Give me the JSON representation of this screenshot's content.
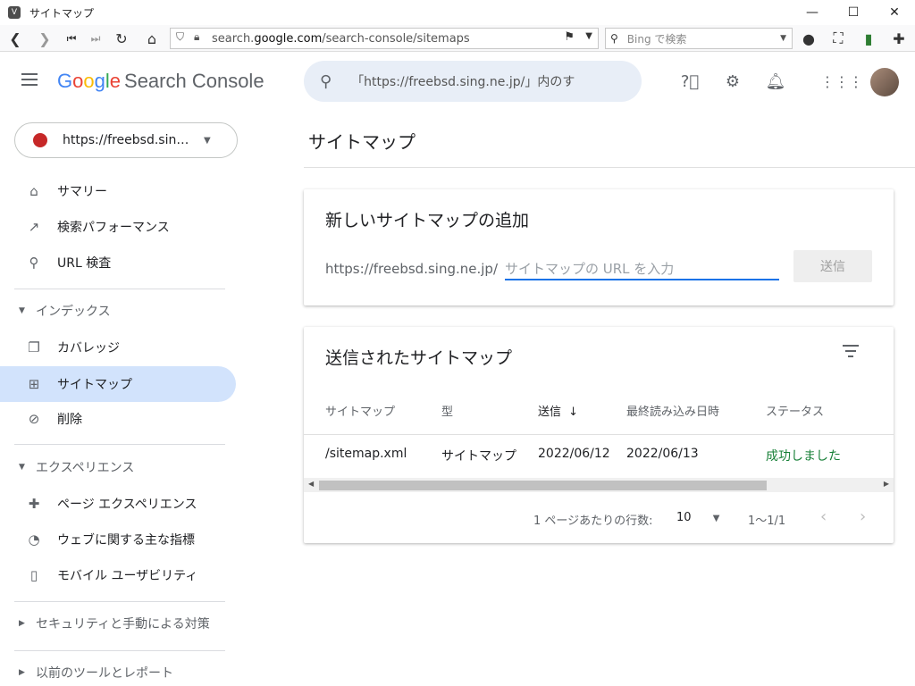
{
  "window": {
    "title": "サイトマップ",
    "minimize": "—",
    "maximize": "☐",
    "close": "✕"
  },
  "browser": {
    "url_prefix": "search.",
    "url_host": "google.com",
    "url_path": "/search-console/sitemaps",
    "search_placeholder": "Bing で検索"
  },
  "header": {
    "logo_letters": [
      "G",
      "o",
      "o",
      "g",
      "l",
      "e"
    ],
    "product": "Search Console",
    "search_placeholder": "「https://freebsd.sing.ne.jp/」内のす"
  },
  "sidebar": {
    "property": "https://freebsd.sing.ne.jp/",
    "items": [
      {
        "label": "サマリー",
        "icon": "home-icon",
        "glyph": "⌂"
      },
      {
        "label": "検索パフォーマンス",
        "icon": "trending-icon",
        "glyph": "↗"
      },
      {
        "label": "URL 検査",
        "icon": "search-icon",
        "glyph": "⚲"
      }
    ],
    "section_index": "インデックス",
    "index_items": [
      {
        "label": "カバレッジ",
        "icon": "copy-icon",
        "glyph": "❐"
      },
      {
        "label": "サイトマップ",
        "icon": "sitemap-icon",
        "glyph": "⊞"
      },
      {
        "label": "削除",
        "icon": "visibility-off-icon",
        "glyph": "⊘"
      }
    ],
    "section_experience": "エクスペリエンス",
    "experience_items": [
      {
        "label": "ページ エクスペリエンス",
        "icon": "add-circle-icon",
        "glyph": "✚"
      },
      {
        "label": "ウェブに関する主な指標",
        "icon": "speed-icon",
        "glyph": "◔"
      },
      {
        "label": "モバイル ユーザビリティ",
        "icon": "smartphone-icon",
        "glyph": "▯"
      }
    ],
    "section_security": "セキュリティと手動による対策",
    "section_legacy": "以前のツールとレポート"
  },
  "main": {
    "page_title": "サイトマップ",
    "add_card": {
      "title": "新しいサイトマップの追加",
      "prefix": "https://freebsd.sing.ne.jp/",
      "placeholder": "サイトマップの URL を入力",
      "submit": "送信"
    },
    "submitted_card": {
      "title": "送信されたサイトマップ",
      "columns": [
        "サイトマップ",
        "型",
        "送信",
        "最終読み込み日時",
        "ステータス"
      ],
      "sort_arrow": "↓",
      "rows": [
        {
          "sitemap": "/sitemap.xml",
          "type": "サイトマップ",
          "submitted": "2022/06/12",
          "last_read": "2022/06/13",
          "status": "成功しました"
        }
      ],
      "rows_per_page_label": "1 ページあたりの行数:",
      "rows_per_page": "10",
      "range": "1〜1/1"
    }
  },
  "colors": {
    "accent": "#1a73e8",
    "active_nav": "#d2e3fc",
    "success": "#188038"
  }
}
